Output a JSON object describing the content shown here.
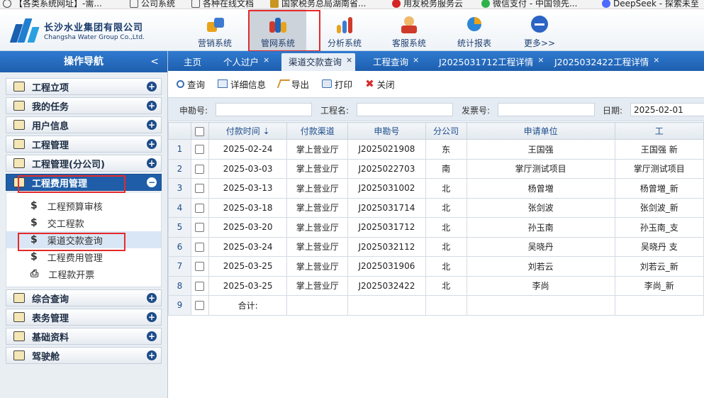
{
  "bookmarks": [
    {
      "icon": "globe-icon",
      "label": "【各类系统网址】-需..."
    },
    {
      "icon": "folder-icon",
      "label": "公司系统"
    },
    {
      "icon": "folder-icon",
      "label": "各种在线文档"
    },
    {
      "icon": "tax-icon",
      "label": "国家税务总局湖南省..."
    },
    {
      "icon": "yonyou-icon",
      "label": "用友税务服务云"
    },
    {
      "icon": "wechat-pay-icon",
      "label": "微信支付 - 中国领先..."
    },
    {
      "icon": "deepseek-icon",
      "label": "DeepSeek - 探索未至"
    }
  ],
  "header": {
    "company_cn": "长沙水业集团有限公司",
    "company_en": "Changsha Water Group Co.,Ltd.",
    "nav": [
      {
        "label": "营销系统",
        "icon": "marketing-icon"
      },
      {
        "label": "管网系统",
        "icon": "pipe-network-icon",
        "active": true
      },
      {
        "label": "分析系统",
        "icon": "analysis-icon"
      },
      {
        "label": "客服系统",
        "icon": "customer-service-icon"
      },
      {
        "label": "统计报表",
        "icon": "statistics-icon"
      },
      {
        "label": "更多>>",
        "icon": "more-icon"
      }
    ]
  },
  "leftnav": {
    "title": "操作导航",
    "collapse_glyph": "<",
    "groups_top": [
      {
        "label": "工程立项",
        "icon": "flag-icon"
      },
      {
        "label": "我的任务",
        "icon": "folder-open-icon"
      },
      {
        "label": "用户信息",
        "icon": "user-card-icon"
      },
      {
        "label": "工程管理",
        "icon": "cabinet-icon"
      },
      {
        "label": "工程管理(分公司)",
        "icon": "cabinet-icon"
      }
    ],
    "active_group": {
      "label": "工程费用管理",
      "icon": "fee-icon"
    },
    "sub_items": [
      {
        "label": "工程预算审核",
        "icon": "dollar-icon"
      },
      {
        "label": "交工程款",
        "icon": "dollar-icon"
      },
      {
        "label": "渠道交款查询",
        "icon": "dollar-icon",
        "active": true
      },
      {
        "label": "工程费用管理",
        "icon": "dollar-icon"
      },
      {
        "label": "工程款开票",
        "icon": "printer-icon"
      }
    ],
    "groups_bottom": [
      {
        "label": "综合查询",
        "icon": "search-group-icon"
      },
      {
        "label": "表务管理",
        "icon": "meter-icon"
      },
      {
        "label": "基础资料",
        "icon": "book-icon"
      },
      {
        "label": "驾驶舱",
        "icon": "cabinet-icon"
      }
    ]
  },
  "tabs": [
    {
      "label": "主页",
      "closable": false
    },
    {
      "label": "个人过户",
      "closable": true
    },
    {
      "label": "渠道交款查询",
      "closable": true,
      "active": true
    },
    {
      "label": "工程查询",
      "closable": true
    },
    {
      "label": "J2025031712工程详情",
      "closable": true
    },
    {
      "label": "J2025032422工程详情",
      "closable": true
    }
  ],
  "close_glyph": "×",
  "toolbar": {
    "query": "查询",
    "details": "详细信息",
    "export": "导出",
    "print": "打印",
    "close": "关闭"
  },
  "filter": {
    "survey_no_label": "申勘号:",
    "survey_no_value": "",
    "project_name_label": "工程名:",
    "project_name_value": "",
    "invoice_no_label": "发票号:",
    "invoice_no_value": "",
    "date_label": "日期:",
    "date_value": "2025-02-01"
  },
  "grid": {
    "columns": [
      "付款时间 ⇣",
      "付款渠道",
      "申勘号",
      "分公司",
      "申请单位",
      "工"
    ],
    "rows": [
      {
        "n": "1",
        "time": "2025-02-24",
        "channel": "掌上营业厅",
        "no": "J2025021908",
        "branch": "东",
        "unit": "王国强",
        "proj": "王国强 新"
      },
      {
        "n": "2",
        "time": "2025-03-03",
        "channel": "掌上营业厅",
        "no": "J2025022703",
        "branch": "南",
        "unit": "掌厅测试项目",
        "proj": "掌厅测试项目"
      },
      {
        "n": "3",
        "time": "2025-03-13",
        "channel": "掌上营业厅",
        "no": "J2025031002",
        "branch": "北",
        "unit": "杨曾増",
        "proj": "杨曾増_新"
      },
      {
        "n": "4",
        "time": "2025-03-18",
        "channel": "掌上营业厅",
        "no": "J2025031714",
        "branch": "北",
        "unit": "张剑波",
        "proj": "张剑波_新"
      },
      {
        "n": "5",
        "time": "2025-03-20",
        "channel": "掌上营业厅",
        "no": "J2025031712",
        "branch": "北",
        "unit": "孙玉南",
        "proj": "孙玉南_支"
      },
      {
        "n": "6",
        "time": "2025-03-24",
        "channel": "掌上营业厅",
        "no": "J2025032112",
        "branch": "北",
        "unit": "吴晓丹",
        "proj": "吴晓丹 支"
      },
      {
        "n": "7",
        "time": "2025-03-25",
        "channel": "掌上营业厅",
        "no": "J2025031906",
        "branch": "北",
        "unit": "刘若云",
        "proj": "刘若云_新"
      },
      {
        "n": "8",
        "time": "2025-03-25",
        "channel": "掌上营业厅",
        "no": "J2025032422",
        "branch": "北",
        "unit": "李尚",
        "proj": "李尚_新"
      }
    ],
    "total_row_n": "9",
    "total_label": "合计:"
  }
}
